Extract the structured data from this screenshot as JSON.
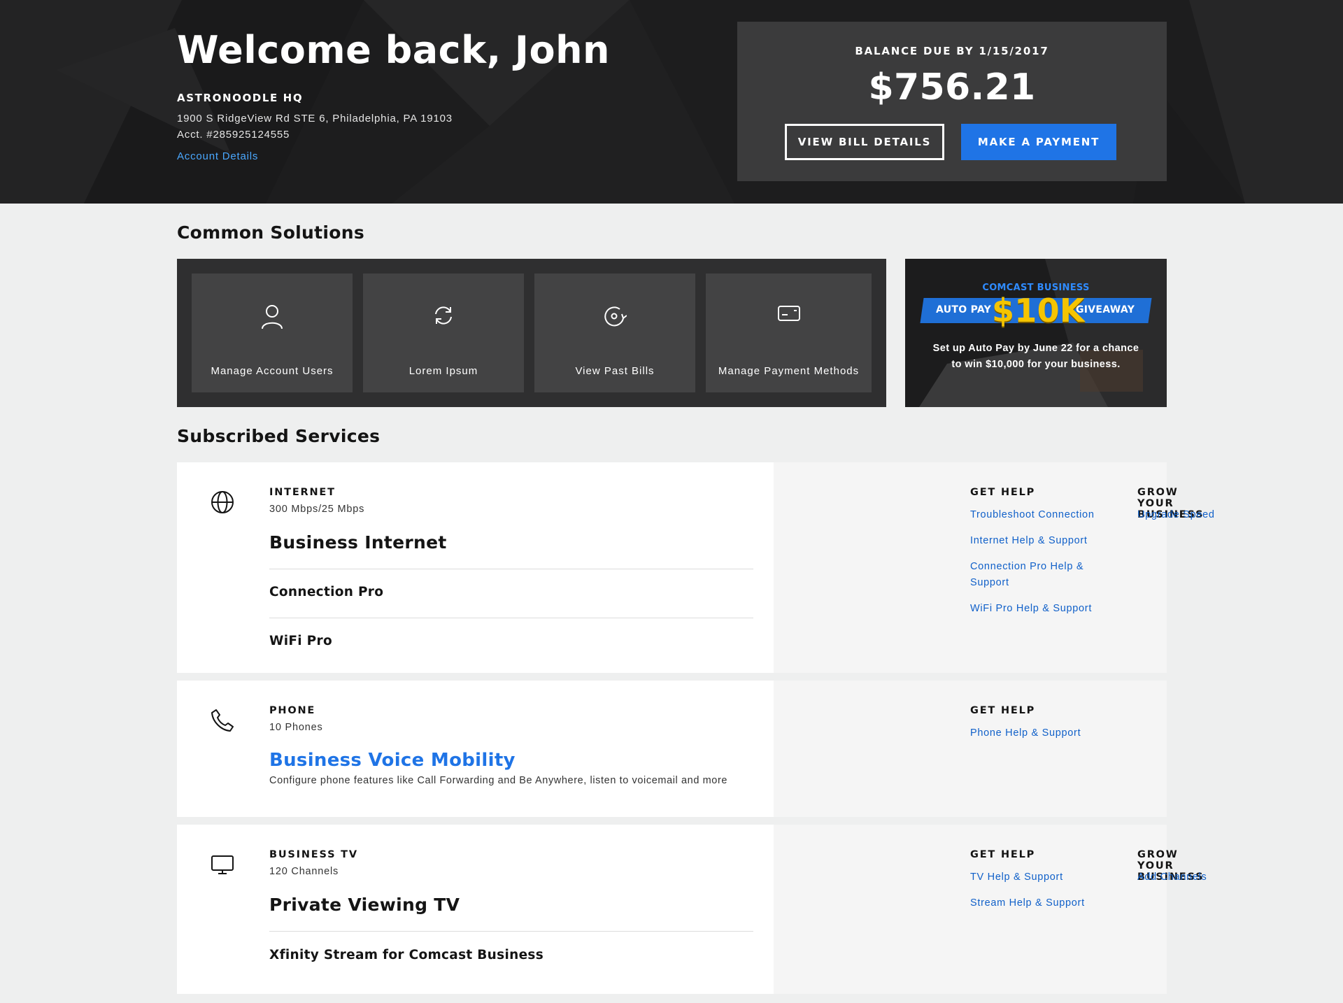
{
  "hero": {
    "greeting": "Welcome back, John",
    "account_name": "ASTRONOODLE HQ",
    "address": "1900 S RidgeView Rd STE 6, Philadelphia, PA 19103",
    "account_number": "Acct. #285925124555",
    "account_details_link": "Account Details"
  },
  "bill": {
    "label": "BALANCE DUE BY 1/15/2017",
    "amount": "$756.21",
    "view_bill_button": "VIEW BILL DETAILS",
    "make_payment_button": "MAKE A PAYMENT",
    "accent": "#1f74e6"
  },
  "common_solutions": {
    "title": "Common Solutions",
    "tiles": [
      {
        "label": "Manage Account Users",
        "icon": "user-icon"
      },
      {
        "label": "Lorem Ipsum",
        "icon": "refresh-icon"
      },
      {
        "label": "View Past Bills",
        "icon": "history-icon"
      },
      {
        "label": "Manage Payment Methods",
        "icon": "credit-card-icon"
      }
    ]
  },
  "promo": {
    "brand": "COMCAST BUSINESS",
    "ribbon_left": "AUTO PAY",
    "ribbon_big": "$10K",
    "ribbon_right": "GIVEAWAY",
    "line1": "Set up Auto Pay by June 22 for a chance",
    "line2": "to win $10,000 for your business."
  },
  "subscribed": {
    "title": "Subscribed Services",
    "internet": {
      "category": "INTERNET",
      "subtitle": "300 Mbps/25 Mbps",
      "name": "Business Internet",
      "items": [
        "Connection Pro",
        "WiFi Pro"
      ],
      "get_help_title": "GET HELP",
      "help_links": [
        "Troubleshoot Connection",
        "Internet Help & Support",
        "Connection Pro Help & Support",
        "WiFi Pro Help & Support"
      ],
      "grow_title": "GROW YOUR BUSINESS",
      "grow_links": [
        "Upgrade Speed"
      ]
    },
    "phone": {
      "category": "PHONE",
      "subtitle": "10 Phones",
      "name": "Business Voice Mobility",
      "description": "Configure phone features like Call Forwarding and Be Anywhere, listen to voicemail and more",
      "get_help_title": "GET HELP",
      "help_links": [
        "Phone Help & Support"
      ]
    },
    "tv": {
      "category": "BUSINESS TV",
      "subtitle": "120 Channels",
      "name": "Private Viewing TV",
      "items": [
        "Xfinity Stream for Comcast Business"
      ],
      "get_help_title": "GET HELP",
      "help_links": [
        "TV Help & Support",
        "Stream Help & Support"
      ],
      "grow_title": "GROW YOUR BUSINESS",
      "grow_links": [
        "Add Channels"
      ]
    }
  }
}
